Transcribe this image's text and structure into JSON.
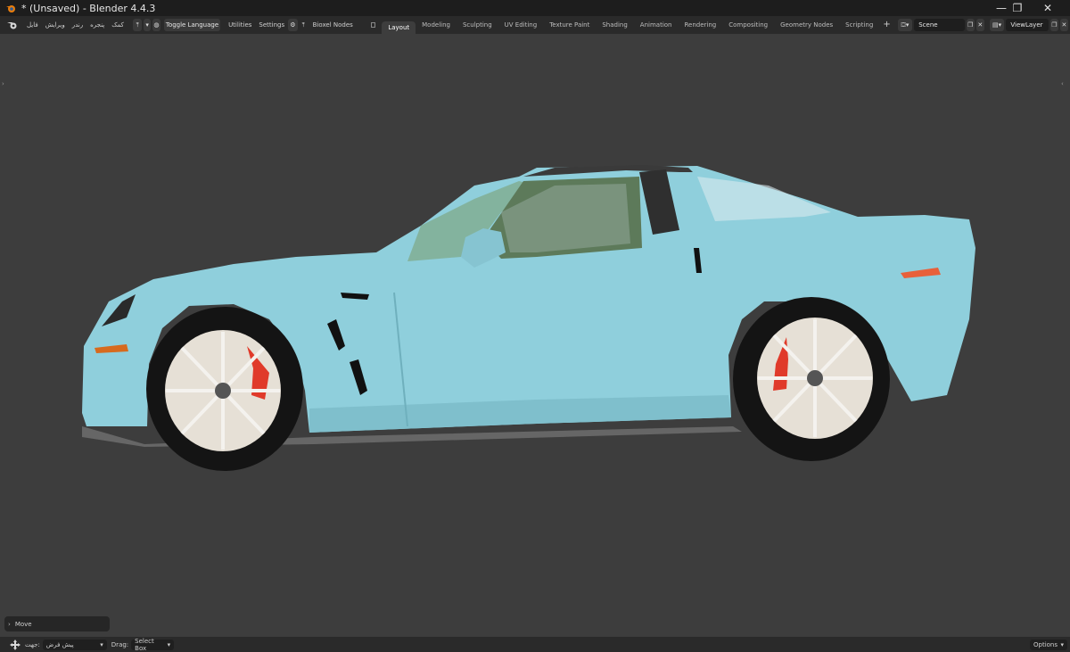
{
  "window": {
    "title": "* (Unsaved) - Blender 4.4.3",
    "minimize_glyph": "—",
    "restore_glyph": "❐",
    "close_glyph": "✕"
  },
  "menu": {
    "items": [
      "فایل",
      "ویرایش",
      "رندر",
      "پنجره",
      "کمک"
    ],
    "toggle_language": "Toggle Language",
    "utilities": "Utilities",
    "settings": "Settings",
    "bioxel_nodes": "Bioxel Nodes"
  },
  "workspaces": {
    "tabs": [
      "Layout",
      "Modeling",
      "Sculpting",
      "UV Editing",
      "Texture Paint",
      "Shading",
      "Animation",
      "Rendering",
      "Compositing",
      "Geometry Nodes",
      "Scripting"
    ],
    "active": "Layout",
    "add_glyph": "+"
  },
  "scene": {
    "name": "Scene"
  },
  "view_layer": {
    "name": "ViewLayer"
  },
  "last_operation": {
    "label": "Move"
  },
  "statusbar": {
    "direction_label": "جهت:",
    "direction_value": "پیش فرض",
    "drag_label": "Drag:",
    "drag_value": "Select Box",
    "options": "Options"
  },
  "colors": {
    "car_body": "#8fcfdc",
    "tire": "#141414",
    "rim": "#e6e0d6",
    "brake_caliper": "#e03a2a",
    "viewport_bg": "#3d3d3d"
  }
}
